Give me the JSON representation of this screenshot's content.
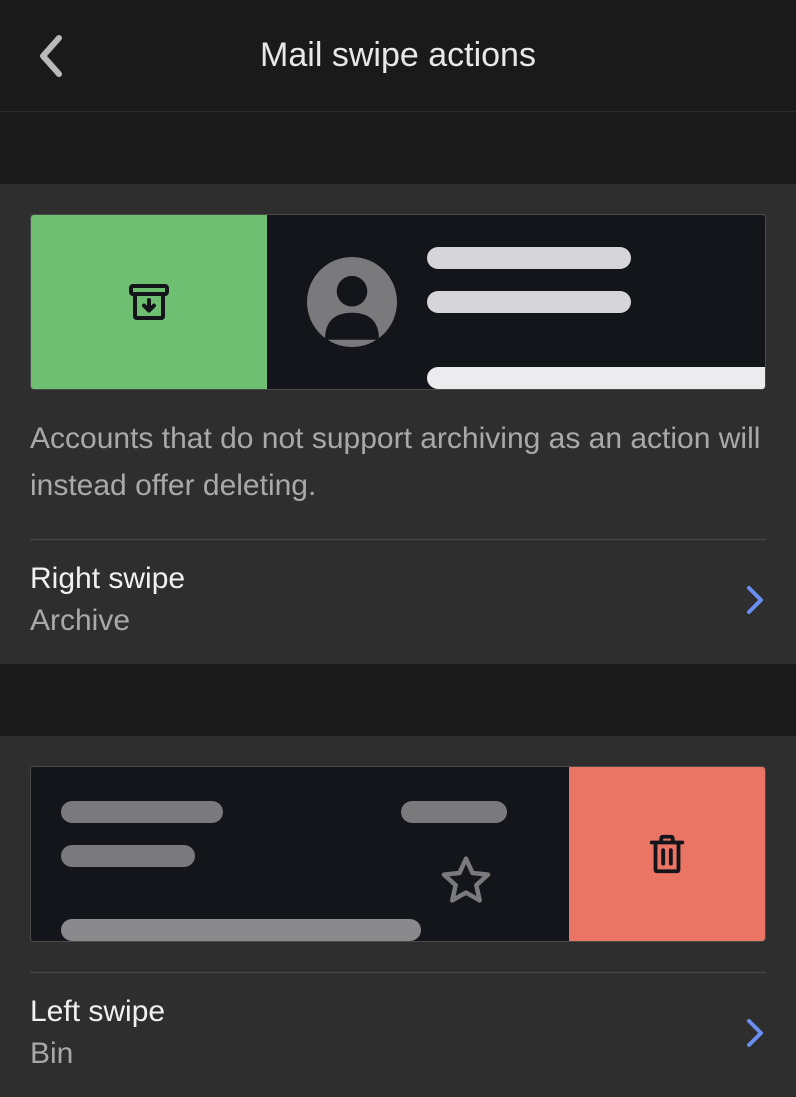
{
  "header": {
    "title": "Mail swipe actions"
  },
  "rightSwipe": {
    "description": "Accounts that do not support archiving as an action will instead offer deleting.",
    "label": "Right swipe",
    "value": "Archive",
    "action_icon": "archive-icon",
    "zone_color": "#6fbf73"
  },
  "leftSwipe": {
    "label": "Left swipe",
    "value": "Bin",
    "action_icon": "trash-icon",
    "zone_color": "#eb7564"
  }
}
